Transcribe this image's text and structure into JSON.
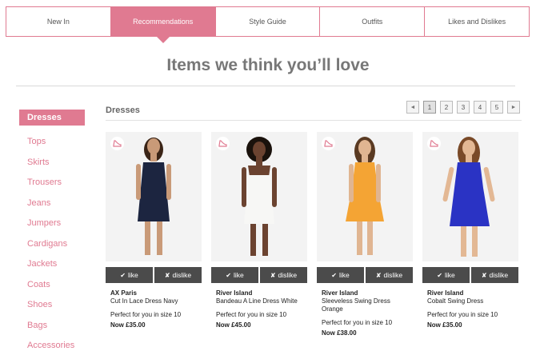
{
  "tabs": [
    "New In",
    "Recommendations",
    "Style Guide",
    "Outfits",
    "Likes and Dislikes"
  ],
  "page_title": "Items we think you’ll love",
  "sidebar": {
    "items": [
      "Dresses",
      "Tops",
      "Skirts",
      "Trousers",
      "Jeans",
      "Jumpers",
      "Cardigans",
      "Jackets",
      "Coats",
      "Shoes",
      "Bags",
      "Accessories"
    ]
  },
  "section_title": "Dresses",
  "pagination": {
    "prev": "◄",
    "pages": [
      "1",
      "2",
      "3",
      "4",
      "5"
    ],
    "next": "►",
    "current": "1"
  },
  "buttons": {
    "like": "like",
    "dislike": "dislike",
    "like_icon": "✔",
    "dislike_icon": "✘"
  },
  "colors": {
    "accent": "#e07a91",
    "button": "#4b4b4b"
  },
  "products": [
    {
      "brand": "AX Paris",
      "name": "Cut In Lace Dress Navy",
      "fit": "Perfect for you in size 10",
      "price": "Now £35.00",
      "dress_color": "#1c2540",
      "skin": "#c99a78",
      "hair": "#3a2416"
    },
    {
      "brand": "River Island",
      "name": "Bandeau A Line Dress White",
      "fit": "Perfect for you in size 10",
      "price": "Now £45.00",
      "dress_color": "#f7f7f5",
      "skin": "#6b4330",
      "hair": "#1a120c"
    },
    {
      "brand": "River Island",
      "name": "Sleeveless Swing Dress Orange",
      "fit": "Perfect for you in size 10",
      "price": "Now £38.00",
      "dress_color": "#f4a434",
      "skin": "#e0b591",
      "hair": "#5a3a22"
    },
    {
      "brand": "River Island",
      "name": "Cobalt Swing Dress",
      "fit": "Perfect for you in size 10",
      "price": "Now £35.00",
      "dress_color": "#2a33c4",
      "skin": "#e3b894",
      "hair": "#7a4a28"
    }
  ]
}
